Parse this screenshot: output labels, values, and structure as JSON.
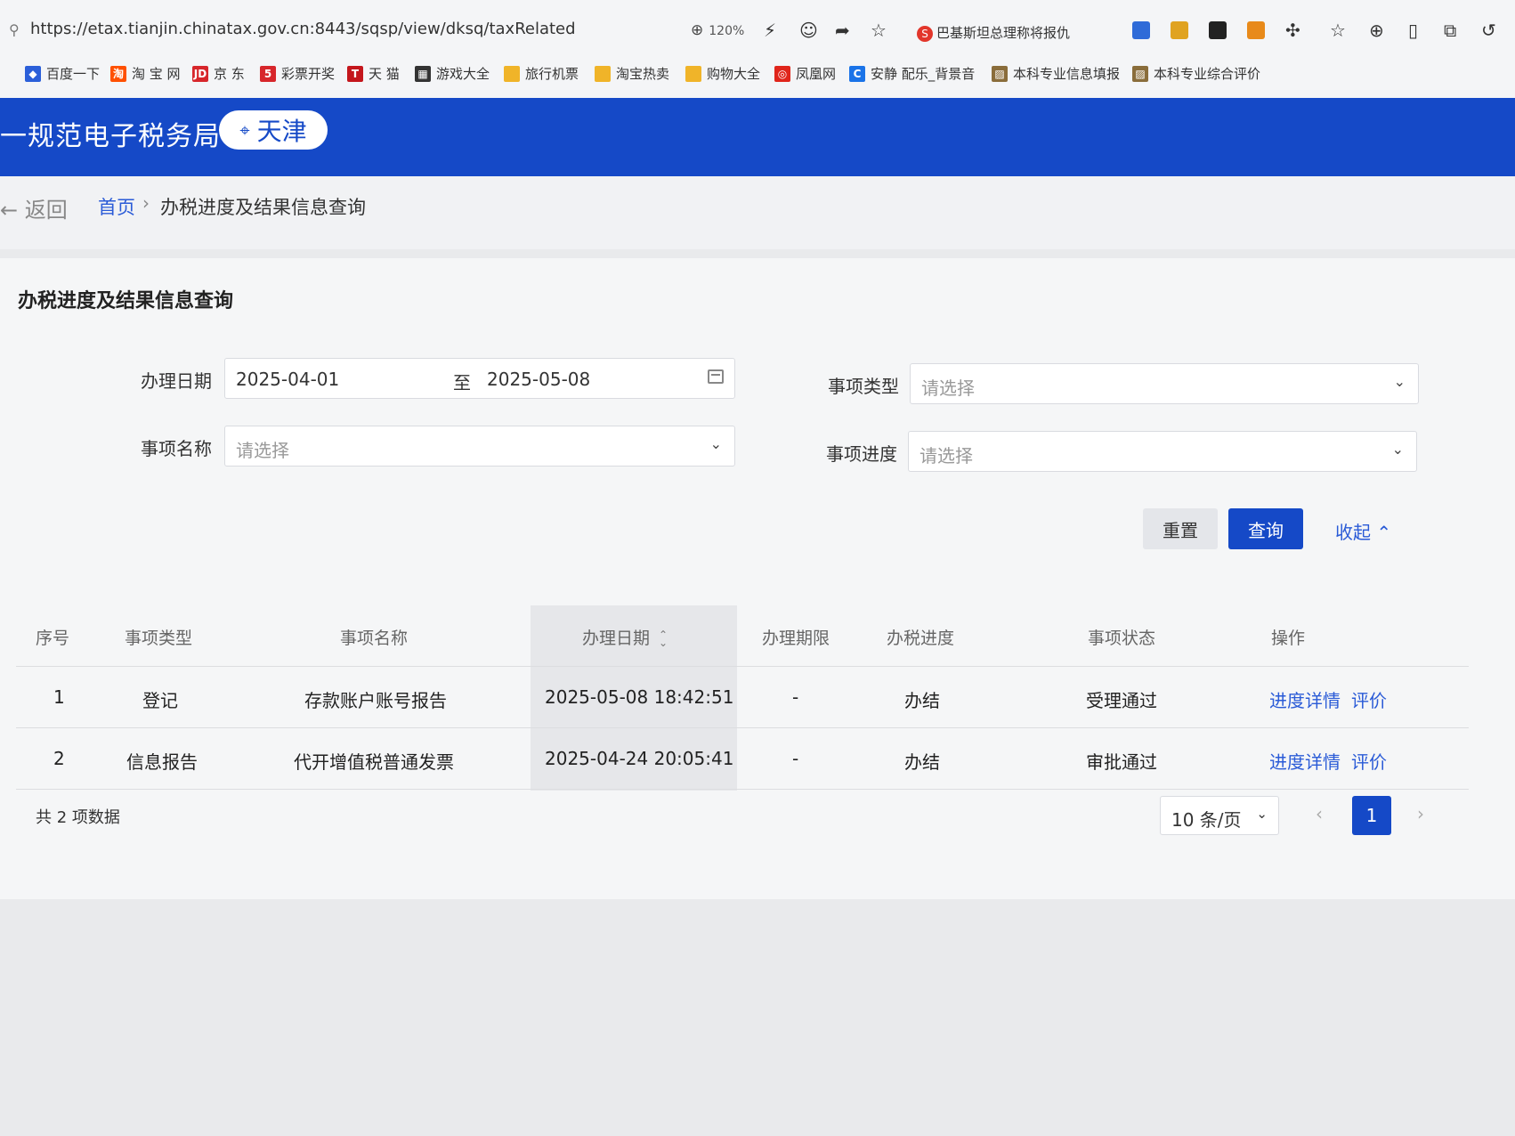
{
  "browser": {
    "url": "https://etax.tianjin.chinatax.gov.cn:8443/sqsp/view/dksq/taxRelated",
    "zoom": "120%",
    "search_hint": "巴基斯坦总理称将报仇",
    "bookmarks": [
      {
        "label": "百度一下",
        "icon": "baidu-icon",
        "color": "#2b5fd9"
      },
      {
        "label": "淘 宝 网",
        "icon": "taobao-icon",
        "color": "#ff5000"
      },
      {
        "label": "京 东",
        "icon": "jd-icon",
        "color": "#d7262b"
      },
      {
        "label": "彩票开奖",
        "icon": "lottery-icon",
        "color": "#d7262b"
      },
      {
        "label": "天 猫",
        "icon": "tmall-icon",
        "color": "#c4161c"
      },
      {
        "label": "游戏大全",
        "icon": "game-icon",
        "color": "#333333"
      },
      {
        "label": "旅行机票",
        "icon": "folder-icon",
        "color": "#f0b429"
      },
      {
        "label": "淘宝热卖",
        "icon": "folder-icon",
        "color": "#f0b429"
      },
      {
        "label": "购物大全",
        "icon": "folder-icon",
        "color": "#f0b429"
      },
      {
        "label": "凤凰网",
        "icon": "ifeng-icon",
        "color": "#e0251b"
      },
      {
        "label": "安静 配乐_背景音",
        "icon": "music-icon",
        "color": "#1a73e8"
      },
      {
        "label": "本科专业信息填报",
        "icon": "image-icon",
        "color": "#8a6d3b"
      },
      {
        "label": "本科专业综合评价",
        "icon": "image-icon",
        "color": "#8a6d3b"
      }
    ]
  },
  "header": {
    "title": "一规范电子税务局",
    "region": "天津",
    "color": "#1549c7"
  },
  "breadcrumb": {
    "back": "返回",
    "home": "首页",
    "separator": "›",
    "current": "办税进度及结果信息查询"
  },
  "panel": {
    "title": "办税进度及结果信息查询"
  },
  "form": {
    "date_label": "办理日期",
    "date_start": "2025-04-01",
    "date_to": "至",
    "date_end": "2025-05-08",
    "type_label": "事项类型",
    "name_label": "事项名称",
    "progress_label": "事项进度",
    "placeholder": "请选择",
    "reset": "重置",
    "query": "查询",
    "collapse": "收起"
  },
  "table": {
    "columns": [
      "序号",
      "事项类型",
      "事项名称",
      "办理日期",
      "办理期限",
      "办税进度",
      "事项状态",
      "操作"
    ],
    "rows": [
      {
        "no": "1",
        "type": "登记",
        "name": "存款账户账号报告",
        "date": "2025-05-08 18:42:51",
        "limit": "-",
        "progress": "办结",
        "status": "受理通过",
        "op1": "进度详情",
        "op2": "评价"
      },
      {
        "no": "2",
        "type": "信息报告",
        "name": "代开增值税普通发票",
        "date": "2025-04-24 20:05:41",
        "limit": "-",
        "progress": "办结",
        "status": "审批通过",
        "op1": "进度详情",
        "op2": "评价"
      }
    ]
  },
  "footer": {
    "total": "共 2 项数据",
    "page_size": "10 条/页",
    "current_page": "1"
  }
}
